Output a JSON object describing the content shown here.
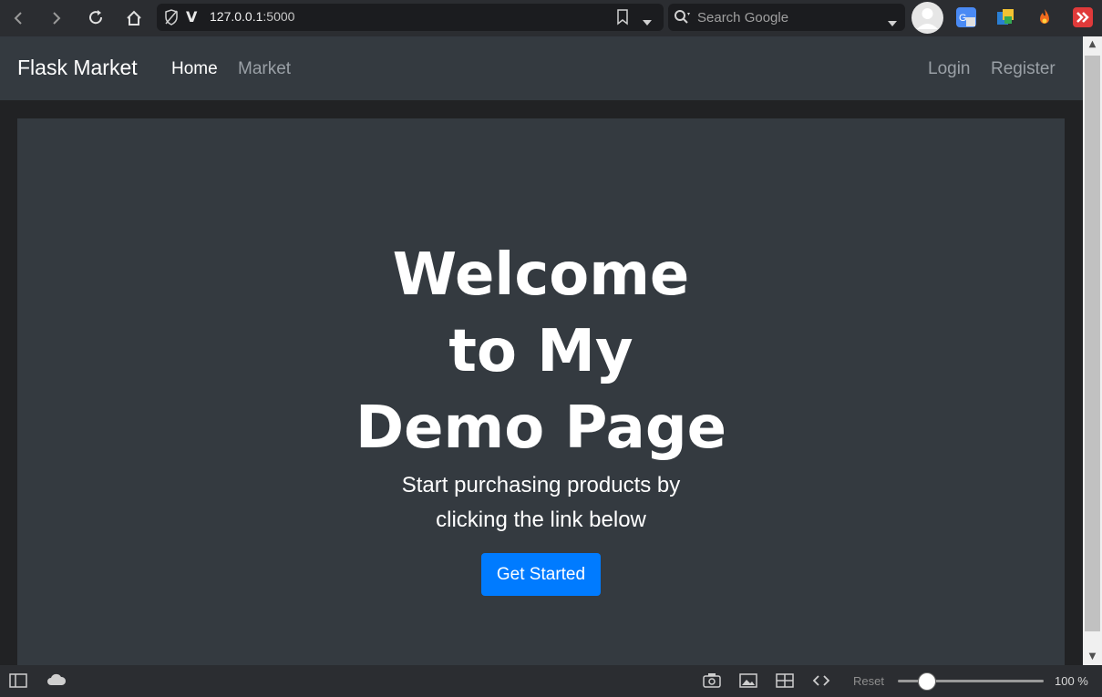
{
  "browser": {
    "url_host": "127.0.0.1",
    "url_port": ":5000",
    "search_placeholder": "Search Google"
  },
  "navbar": {
    "brand": "Flask Market",
    "links": [
      {
        "label": "Home",
        "active": true
      },
      {
        "label": "Market",
        "active": false
      }
    ],
    "right_links": [
      {
        "label": "Login"
      },
      {
        "label": "Register"
      }
    ]
  },
  "hero": {
    "title_lines": [
      "Welcome",
      "to My",
      "Demo Page"
    ],
    "subtitle_lines": [
      "Start purchasing products by",
      "clicking the link below"
    ],
    "cta_label": "Get Started"
  },
  "statusbar": {
    "reset_label": "Reset",
    "zoom_label": "100 %",
    "zoom_level": 0.2
  },
  "colors": {
    "accent": "#007bff",
    "navbar_bg": "#343a40",
    "active_link": "#ffffff",
    "inactive_link": "#9aa0a6"
  },
  "icons": [
    "back-icon",
    "forward-icon",
    "reload-icon",
    "home-icon",
    "shield-icon",
    "vivaldi-icon",
    "bookmark-icon",
    "dropdown-icon",
    "search-icon",
    "avatar-icon",
    "translate-icon",
    "extension-icon",
    "fire-icon",
    "pocket-icon",
    "panel-icon",
    "cloud-icon",
    "camera-icon",
    "image-icon",
    "tile-icon",
    "code-icon"
  ]
}
